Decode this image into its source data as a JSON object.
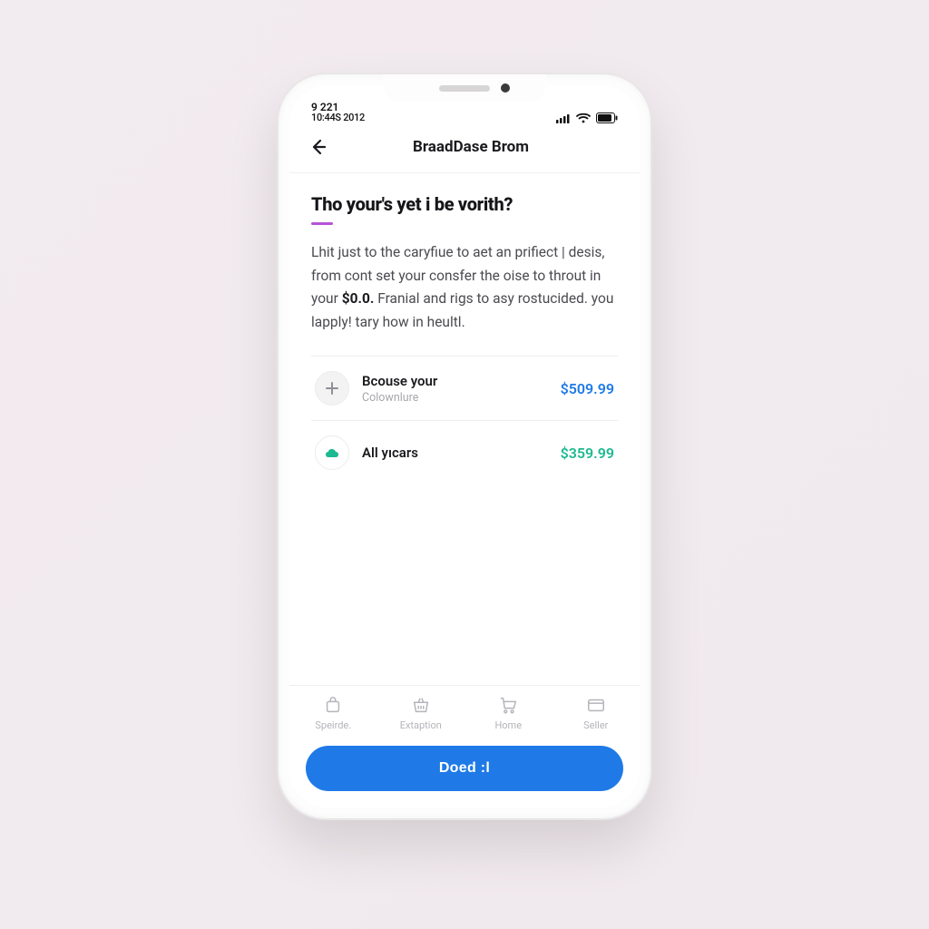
{
  "statusbar": {
    "line1": "9 221",
    "line2": "10:44S 2012"
  },
  "header": {
    "title": "BraadDase Brom"
  },
  "content": {
    "headline": "Tho your's yet i be vorith?",
    "body_before": "Lhit just to the caryfiue to aet an prifiect | desis, from cont set your consfer the oise to throut in your ",
    "body_bold": "$0.0.",
    "body_after": " Franial and rigs to asy rostucided. you lapply! tary how in heultl."
  },
  "rows": [
    {
      "title": "Bcouse your",
      "subtitle": "Colownlure",
      "value": "$509.99",
      "value_color": "blue",
      "icon": "plus"
    },
    {
      "title": "All yıcars",
      "subtitle": "",
      "value": "$359.99",
      "value_color": "green",
      "icon": "cloud"
    }
  ],
  "tabs": [
    {
      "label": "Speirde.",
      "icon": "bag"
    },
    {
      "label": "Extaption",
      "icon": "basket"
    },
    {
      "label": "Home",
      "icon": "cart"
    },
    {
      "label": "Seller",
      "icon": "card"
    }
  ],
  "cta": {
    "label": "Doed :l"
  },
  "colors": {
    "primary": "#1f7ae8",
    "accent": "#b653d6",
    "success": "#1db990"
  }
}
